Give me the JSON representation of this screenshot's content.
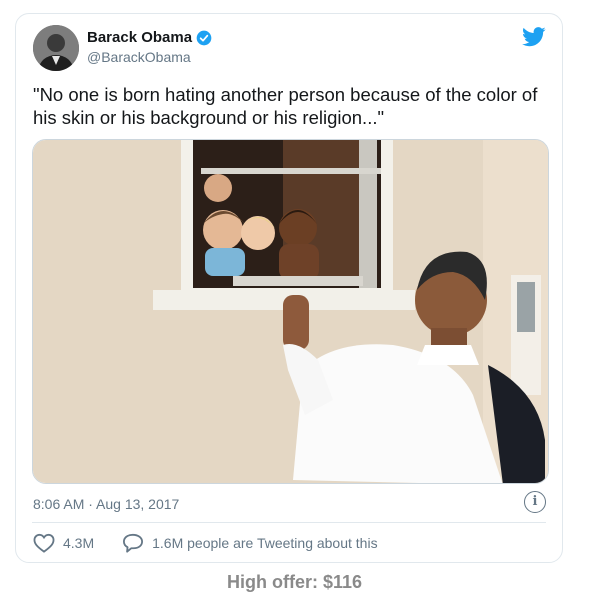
{
  "author": {
    "name": "Barack Obama",
    "handle": "@BarackObama",
    "verified": true,
    "avatar_icon": "avatar-photo"
  },
  "tweet": {
    "text": "\"No one is born hating another person because of the color of his skin or his background or his religion...\"",
    "timestamp": "8:06 AM · Aug 13, 2017",
    "likes": "4.3M",
    "conversation": "1.6M people are Tweeting about this"
  },
  "icons": {
    "brand": "twitter-bird-icon",
    "info": "info-icon",
    "like": "heart-icon",
    "reply": "speech-bubble-icon"
  },
  "colors": {
    "brand_blue": "#1da1f2",
    "secondary_text": "#657786",
    "border": "#e1e8ed",
    "offer_text": "#8a8a8a"
  },
  "offer": {
    "label": "High offer: $116"
  }
}
